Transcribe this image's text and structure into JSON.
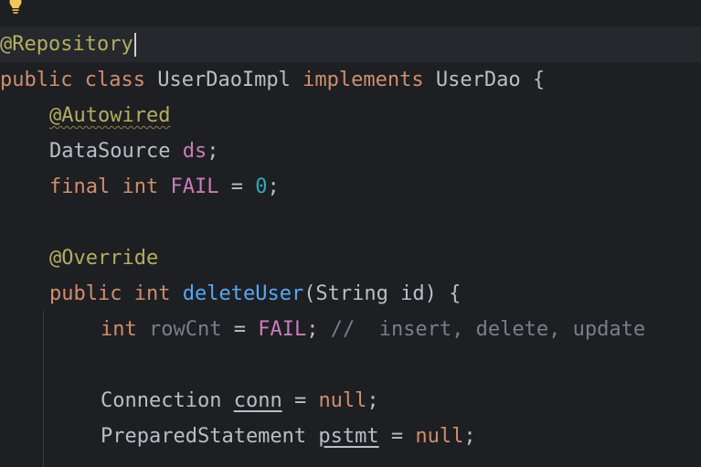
{
  "editor": {
    "lines": {
      "l1": {
        "annot": "@Repository"
      },
      "l2": {
        "kw1": "public",
        "kw2": "class",
        "name": "UserDaoImpl",
        "kw3": "implements",
        "iface": "UserDao",
        "brace": "{"
      },
      "l3": {
        "annot": "@Autowired"
      },
      "l4": {
        "type": "DataSource",
        "field": "ds",
        "semi": ";"
      },
      "l5": {
        "kw1": "final",
        "kw2": "int",
        "const": "FAIL",
        "eq": "=",
        "num": "0",
        "semi": ";"
      },
      "l6": {
        "annot": "@Override"
      },
      "l7": {
        "kw1": "public",
        "kw2": "int",
        "fn": "deleteUser",
        "params": "(String id) {"
      },
      "l8": {
        "kw": "int",
        "var": "rowCnt",
        "eq": "=",
        "const": "FAIL",
        "semi": ";",
        "comment": "//  insert, delete, update"
      },
      "l9": {
        "type": "Connection",
        "var": "conn",
        "eq": "=",
        "kw": "null",
        "semi": ";"
      },
      "l10": {
        "type": "PreparedStatement",
        "var": "pstmt",
        "eq": "=",
        "kw": "null",
        "semi": ";"
      }
    }
  },
  "icons": {
    "intention": "lightbulb-icon"
  },
  "colors": {
    "background": "#1e1f22",
    "current_line": "#26282e",
    "keyword": "#cf8e6d",
    "annotation": "#b3ae60",
    "field": "#c77dbb",
    "number": "#2aacb8",
    "function": "#56a8f5",
    "comment": "#7a7e85",
    "text": "#bcbec4"
  }
}
